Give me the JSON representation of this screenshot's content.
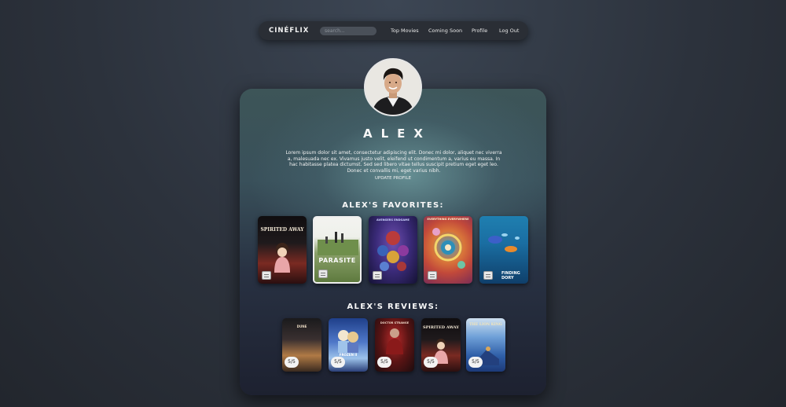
{
  "nav": {
    "brand": "CINÉFLIX",
    "search_placeholder": "search...",
    "links": [
      "Top Movies",
      "Coming Soon",
      "Profile",
      "Log Out"
    ]
  },
  "profile": {
    "name": "ALEX",
    "bio": "Lorem ipsum dolor sit amet, consectetur adipiscing elit. Donec mi dolor, aliquet nec viverra a, malesuada nec ex. Vivamus justo velit, eleifend ut condimentum a, varius eu massa. In hac habitasse platea dictumst. Sed sed libero vitae tellus suscipit pretium eget eget leo. Donec et convallis mi, eget varius nibh.",
    "update_label": "UPDATE PROFILE"
  },
  "favorites": {
    "title": "ALEX'S FAVORITES:",
    "posters": [
      {
        "title": "SPIRITED AWAY",
        "icon": "bookmark-icon",
        "selected": false
      },
      {
        "title": "PARASITE",
        "icon": "bookmark-icon",
        "selected": true
      },
      {
        "title": "AVENGERS ENDGAME",
        "icon": "bookmark-icon",
        "selected": false
      },
      {
        "title": "EVERYTHING EVERYWHERE",
        "icon": "bookmark-icon",
        "selected": false
      },
      {
        "title": "FINDING DORY",
        "icon": "bookmark-icon",
        "selected": false
      }
    ]
  },
  "reviews": {
    "title": "ALEX'S REVIEWS:",
    "items": [
      {
        "title": "DUNE",
        "rating": "5/5"
      },
      {
        "title": "FROZEN II",
        "rating": "5/5"
      },
      {
        "title": "DOCTOR STRANGE",
        "rating": "5/5"
      },
      {
        "title": "SPIRITED AWAY",
        "rating": "5/5"
      },
      {
        "title": "THE LION KING",
        "rating": "5/5"
      }
    ]
  },
  "colors": {
    "background": "#2c323c",
    "nav": "#2a2e35",
    "card_top": "#3d5558",
    "card_bottom": "#1d2130"
  }
}
